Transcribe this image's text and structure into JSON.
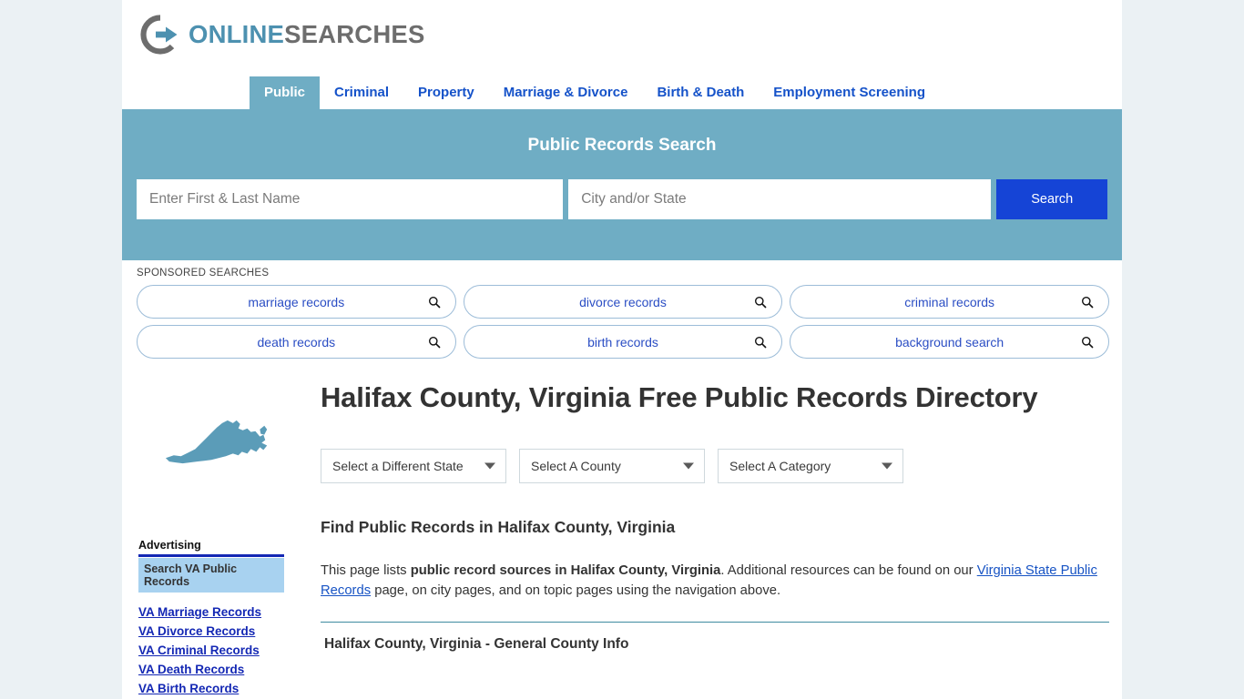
{
  "brand": {
    "logo_icon": "circular-arrow-logo-icon",
    "name_part1": "ONLINE",
    "name_part2": "SEARCHES",
    "accent_teal": "#6fadc4",
    "accent_blue": "#1544d6",
    "link_blue": "#1428b4"
  },
  "nav": {
    "tabs": [
      {
        "label": "Public",
        "active": true
      },
      {
        "label": "Criminal",
        "active": false
      },
      {
        "label": "Property",
        "active": false
      },
      {
        "label": "Marriage & Divorce",
        "active": false
      },
      {
        "label": "Birth & Death",
        "active": false
      },
      {
        "label": "Employment Screening",
        "active": false
      }
    ]
  },
  "search": {
    "title": "Public Records Search",
    "name_placeholder": "Enter First & Last Name",
    "name_value": "",
    "city_placeholder": "City and/or State",
    "city_value": "",
    "button_label": "Search"
  },
  "sponsored": {
    "label": "SPONSORED SEARCHES",
    "icon": "search-icon",
    "pills": [
      "marriage records",
      "divorce records",
      "criminal records",
      "death records",
      "birth records",
      "background search"
    ]
  },
  "main": {
    "map_icon": "virginia-state-map-icon",
    "title": "Halifax County, Virginia Free Public Records Directory",
    "selects": [
      {
        "label": "Select a Different State"
      },
      {
        "label": "Select A County"
      },
      {
        "label": "Select A Category"
      }
    ],
    "section_title": "Find Public Records in Halifax County, Virginia",
    "intro": {
      "part1": "This page lists ",
      "bold": "public record sources in Halifax County, Virginia",
      "part2": ". Additional resources can be found on our ",
      "link": "Virginia State Public Records",
      "part3": " page, on city pages, and on topic pages using the navigation above."
    },
    "county_section_heading": "Halifax County, Virginia - General County Info"
  },
  "sidebar": {
    "ad_label": "Advertising",
    "ad_button": "Search VA Public Records",
    "links": [
      "VA Marriage Records",
      "VA Divorce Records",
      "VA Criminal Records",
      "VA Death Records",
      "VA Birth Records"
    ]
  }
}
